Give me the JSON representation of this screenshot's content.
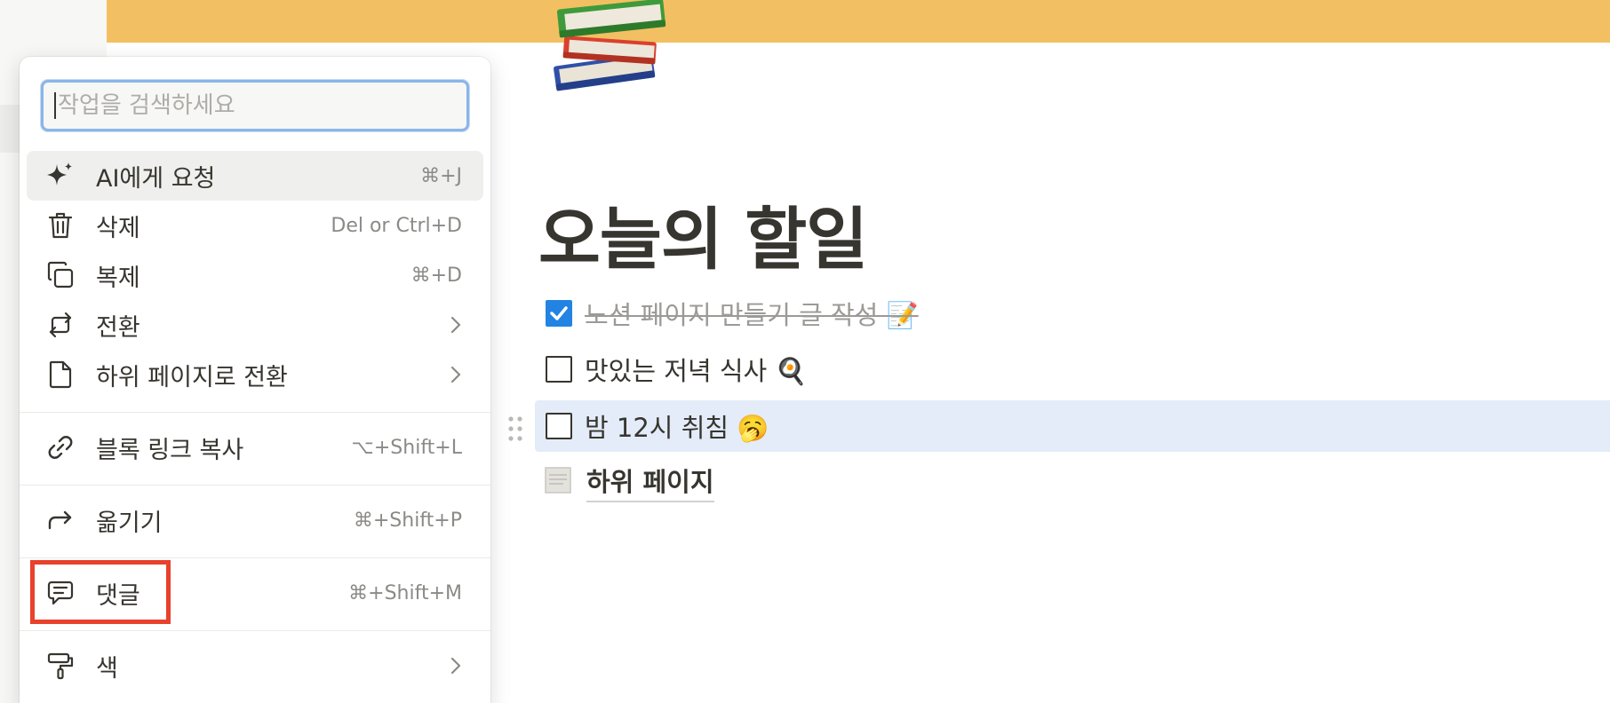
{
  "page": {
    "title": "오늘의 할일",
    "cover_color": "#f2c062",
    "icon": "books-emoji",
    "todos": [
      {
        "text": "노션 페이지 만들기 글 작성 📝",
        "checked": true
      },
      {
        "text": "맛있는 저녁 식사 🍳",
        "checked": false
      },
      {
        "text": "밤 12시 취침 🥱",
        "checked": false
      }
    ],
    "subpage": {
      "icon": "page-icon",
      "title": "하위 페이지"
    }
  },
  "menu": {
    "search_placeholder": "작업을 검색하세요",
    "items": [
      {
        "label": "AI에게 요청",
        "shortcut": "⌘+J",
        "icon": "sparkle-icon"
      },
      {
        "label": "삭제",
        "shortcut": "Del or Ctrl+D",
        "icon": "trash-icon"
      },
      {
        "label": "복제",
        "shortcut": "⌘+D",
        "icon": "duplicate-icon"
      },
      {
        "label": "전환",
        "shortcut": "",
        "icon": "convert-icon"
      },
      {
        "label": "하위 페이지로 전환",
        "shortcut": "",
        "icon": "file-icon"
      },
      {
        "label": "블록 링크 복사",
        "shortcut": "⌥+Shift+L",
        "icon": "link-icon"
      },
      {
        "label": "옮기기",
        "shortcut": "⌘+Shift+P",
        "icon": "move-arrow-icon"
      },
      {
        "label": "댓글",
        "shortcut": "⌘+Shift+M",
        "icon": "comment-icon"
      },
      {
        "label": "색",
        "shortcut": "",
        "icon": "paint-roller-icon"
      }
    ]
  },
  "colors": {
    "accent": "#2383e2",
    "highlight": "#e8412c",
    "hover_row": "#e3ecf8"
  }
}
